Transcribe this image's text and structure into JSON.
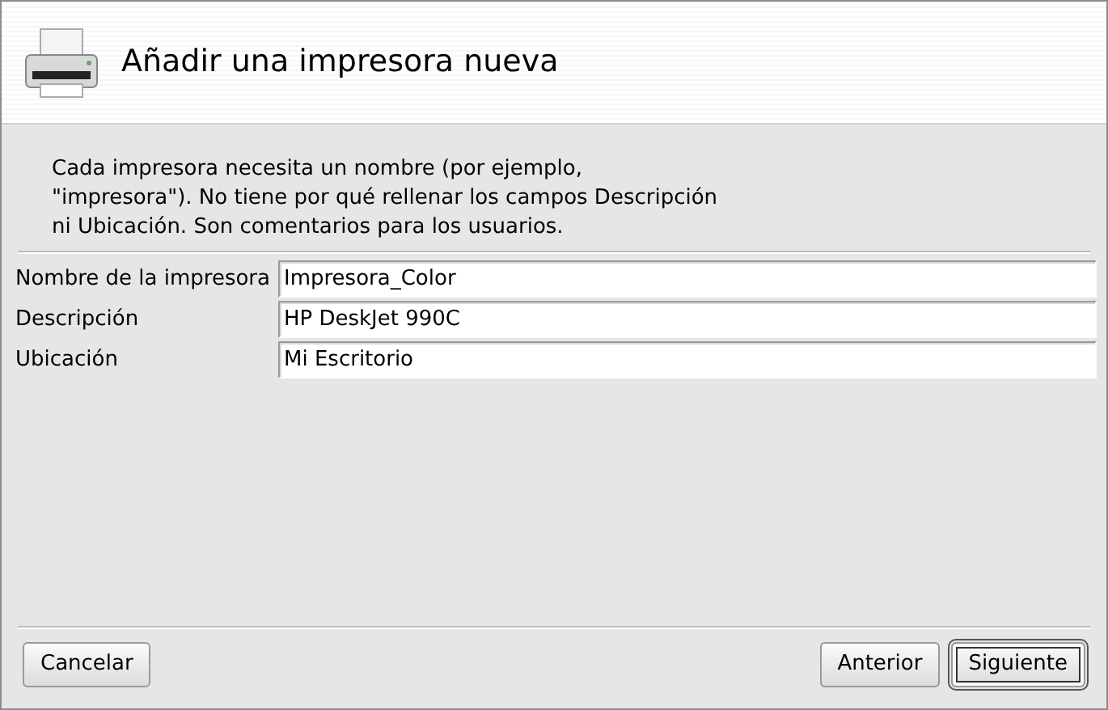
{
  "header": {
    "title": "Añadir una impresora nueva"
  },
  "intro": [
    "Cada impresora necesita un nombre (por ejemplo,",
    "\"impresora\"). No tiene por qué rellenar los campos Descripción",
    "ni Ubicación. Son comentarios para los usuarios."
  ],
  "fields": [
    {
      "label": "Nombre de la impresora",
      "value": "Impresora_Color"
    },
    {
      "label": "Descripción",
      "value": "HP DeskJet 990C"
    },
    {
      "label": "Ubicación",
      "value": "Mi Escritorio"
    }
  ],
  "left_buttons": [
    {
      "label": "Cancelar",
      "default": false
    }
  ],
  "right_buttons": [
    {
      "label": "Anterior",
      "default": false
    },
    {
      "label": "Siguiente",
      "default": true
    }
  ]
}
